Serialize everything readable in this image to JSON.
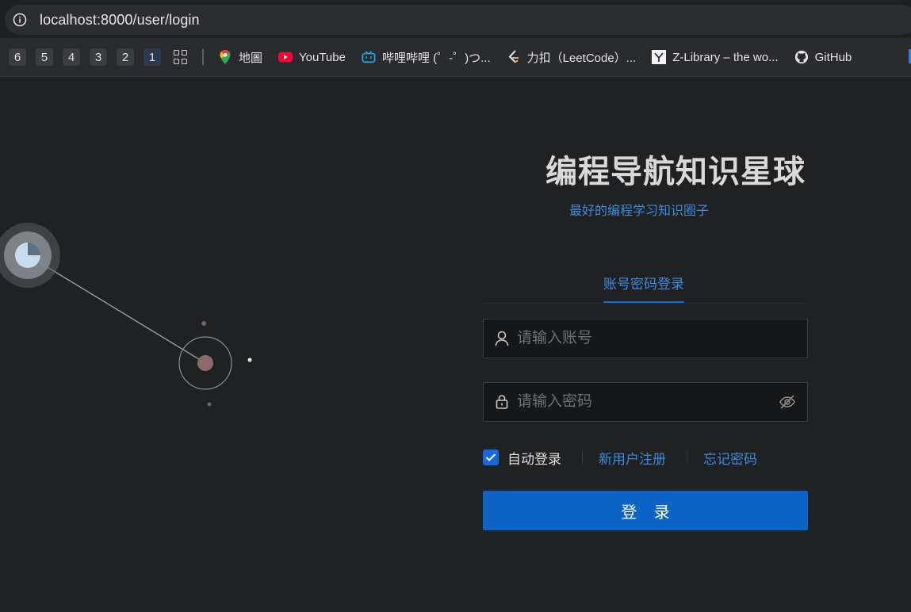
{
  "browser": {
    "url": "localhost:8000/user/login",
    "tab_groups": [
      "6",
      "5",
      "4",
      "3",
      "2",
      "1"
    ],
    "bookmarks": [
      {
        "label": "地圖",
        "icon": "google-maps-icon"
      },
      {
        "label": "YouTube",
        "icon": "youtube-icon"
      },
      {
        "label": "哔哩哔哩 (゜-゜)つ...",
        "icon": "bilibili-icon"
      },
      {
        "label": "力扣（LeetCode）...",
        "icon": "leetcode-icon"
      },
      {
        "label": "Z-Library – the wo...",
        "icon": "zlibrary-icon"
      },
      {
        "label": "GitHub",
        "icon": "github-icon"
      }
    ]
  },
  "login": {
    "title": "编程导航知识星球",
    "subtitle": "最好的编程学习知识圈子",
    "tab": "账号密码登录",
    "username_placeholder": "请输入账号",
    "password_placeholder": "请输入密码",
    "auto_login": "自动登录",
    "auto_login_checked": true,
    "register_link": "新用户注册",
    "forgot_link": "忘记密码",
    "submit": "登 录"
  },
  "colors": {
    "accent": "#1668dc",
    "link": "#3d8bdf",
    "button": "#0d64c7",
    "background": "#1f2123"
  }
}
